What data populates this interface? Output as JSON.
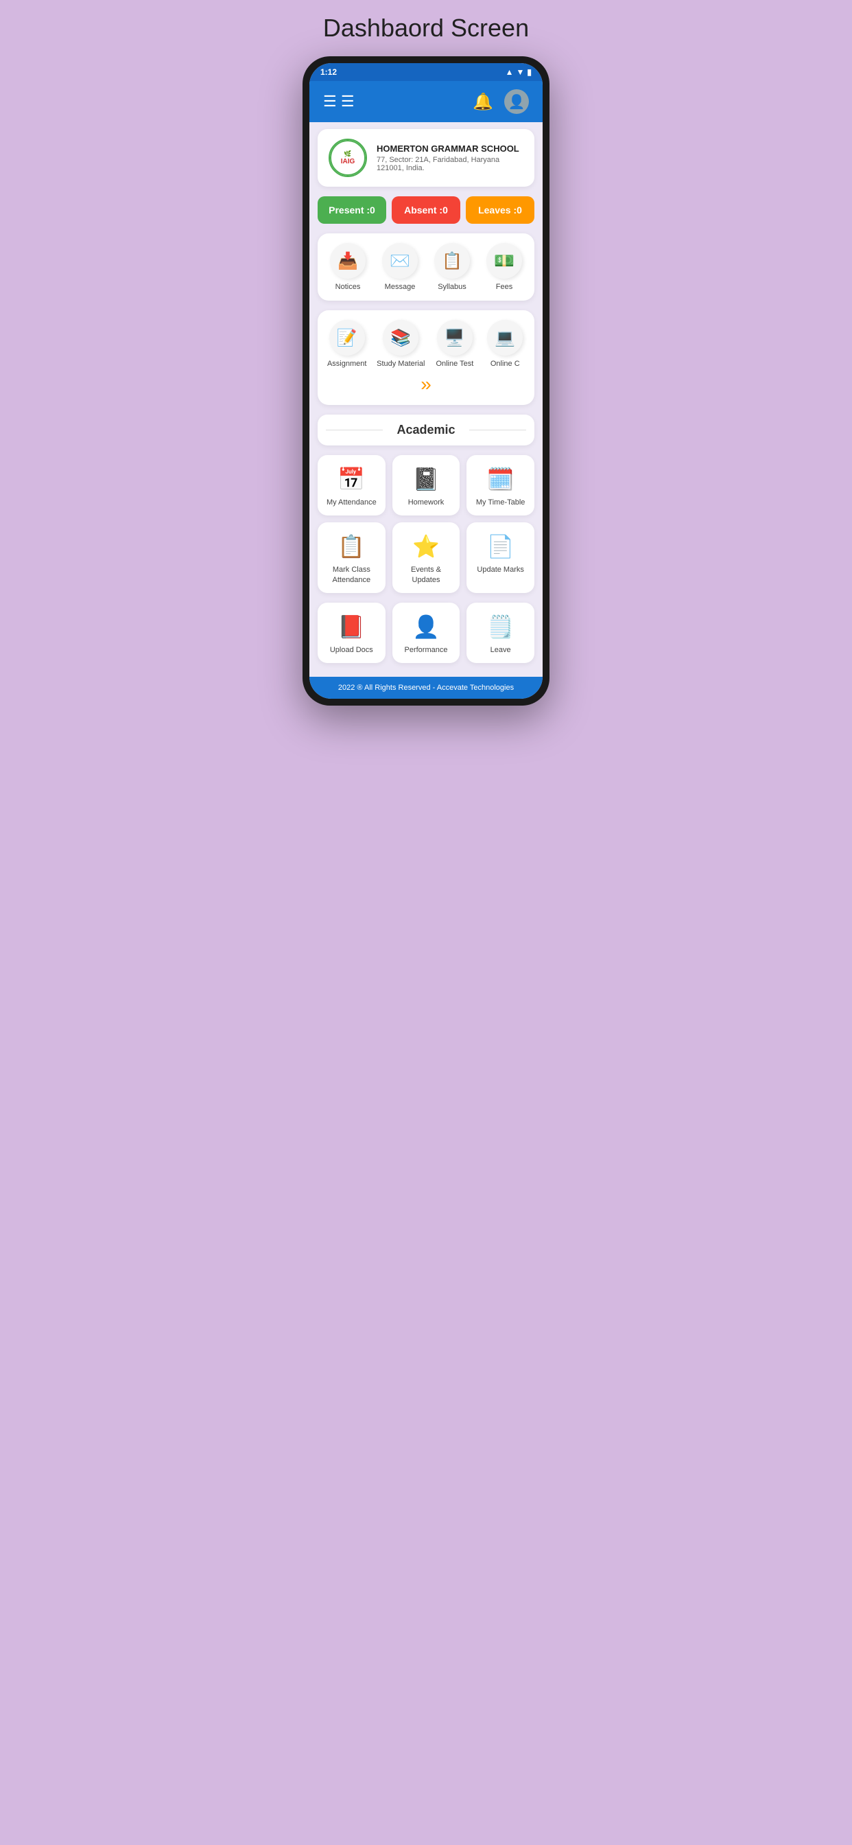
{
  "page": {
    "title": "Dashbaord Screen"
  },
  "statusBar": {
    "time": "1:12",
    "signal": "▲",
    "wifi": "▼",
    "battery": "▮"
  },
  "header": {
    "menuIcon": "☰",
    "bellIcon": "🔔",
    "userIcon": "👤"
  },
  "school": {
    "name": "HOMERTON GRAMMAR SCHOOL",
    "address": "77, Sector: 21A, Faridabad, Haryana 121001, India.",
    "logoText": "IAIG"
  },
  "stats": [
    {
      "label": "Present :0",
      "type": "present"
    },
    {
      "label": "Absent :0",
      "type": "absent"
    },
    {
      "label": "Leaves :0",
      "type": "leaves"
    }
  ],
  "quickMenu": {
    "items": [
      {
        "icon": "📥",
        "label": "Notices"
      },
      {
        "icon": "✉️",
        "label": "Message"
      },
      {
        "icon": "📋",
        "label": "Syllabus"
      },
      {
        "icon": "💵",
        "label": "Fees"
      }
    ]
  },
  "secondMenu": {
    "items": [
      {
        "icon": "📝",
        "label": "Assignment"
      },
      {
        "icon": "📚",
        "label": "Study Material"
      },
      {
        "icon": "🖥️",
        "label": "Online Test"
      },
      {
        "icon": "💻",
        "label": "Online C"
      }
    ],
    "moreIcon": "»"
  },
  "academic": {
    "sectionTitle": "Academic",
    "items": [
      {
        "icon": "📅",
        "label": "My Attendance"
      },
      {
        "icon": "📓",
        "label": "Homework"
      },
      {
        "icon": "🗓️",
        "label": "My Time-Table"
      },
      {
        "icon": "📋",
        "label": "Mark Class Attendance"
      },
      {
        "icon": "⭐",
        "label": "Events & Updates"
      },
      {
        "icon": "📄",
        "label": "Update Marks"
      }
    ]
  },
  "bottomRow": {
    "items": [
      {
        "icon": "📕",
        "label": "Upload Docs"
      },
      {
        "icon": "👤",
        "label": "Performance"
      },
      {
        "icon": "🗒️",
        "label": "Leave"
      }
    ]
  },
  "footer": {
    "text": "2022 ® All Rights Reserved - Accevate Technologies"
  }
}
